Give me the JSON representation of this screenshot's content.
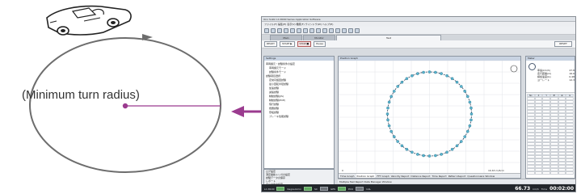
{
  "diagram": {
    "radius_label": "(Minimum turn radius)",
    "car_icon": "convertible-car-icon",
    "circle_color": "#6d6d6d",
    "arrow_color": "#9b3b8f",
    "dot_color": "#9b3b8f"
  },
  "app": {
    "title": "Ono Sokki  LC-8000 Series Application Software",
    "menu": "ファイル(F)   編集(E)   表示(V)   機能(F)   ウインドウ(W)   ヘルプ(H)",
    "tabs": [
      "Main",
      "Monitor",
      "Test"
    ],
    "controls": {
      "ready": "READY",
      "start": "START ▶",
      "stop": "STOP ■",
      "pause": "Pause",
      "reset": "RESET"
    },
    "settings": {
      "title": "Settings",
      "items": [
        "車両諸元・試験条件の設定",
        "車両諸元モード",
        "試験条件モード",
        "試験項目選択",
        "定常円旋回試験",
        "最小回転半径試験",
        "加速試験",
        "減速試験",
        "制動試験(JIS)",
        "制動試験(ECE)",
        "惰行試験",
        "燃費試験",
        "登坂試験",
        "ブレーキ性能試験"
      ],
      "bottom_items": [
        "ログ設定",
        "測定開始トリガの設定",
        "試験データの保存",
        "レポート",
        "データ出力設定"
      ]
    },
    "graph": {
      "title": "Position Graph",
      "tabs": [
        "Time Graph",
        "Position Graph",
        "FFT Graph",
        "Velocity Report",
        "Distance Report",
        "Time Report",
        "Pattern Report",
        "Questionnaire Window"
      ],
      "readout": "16.63 m/6cm",
      "readout_left": "0"
    },
    "bottom_bar": "Multiple Test Report   Data Manager Window",
    "status": {
      "items": [
        "LC-8100",
        "Kagisubmin",
        "SC",
        "GPS",
        "ECU",
        "CAL"
      ],
      "speed_label": "km/h",
      "speed_value": "66.73",
      "time_label": "Time",
      "time_value": "00:02:00"
    },
    "meter": {
      "title": "Meter",
      "gear_label": "1",
      "rows": [
        {
          "k": "車速(km/h)",
          "v": "47.8"
        },
        {
          "k": "走行距離(m)",
          "v": "16.6"
        },
        {
          "k": "横加速度(G)",
          "v": "0.48"
        },
        {
          "k": "ヨーレート",
          "v": "12.3"
        }
      ],
      "grid_head": [
        "No",
        "X",
        "Y",
        "距",
        "速",
        "G"
      ],
      "grid_rows": 24
    }
  }
}
